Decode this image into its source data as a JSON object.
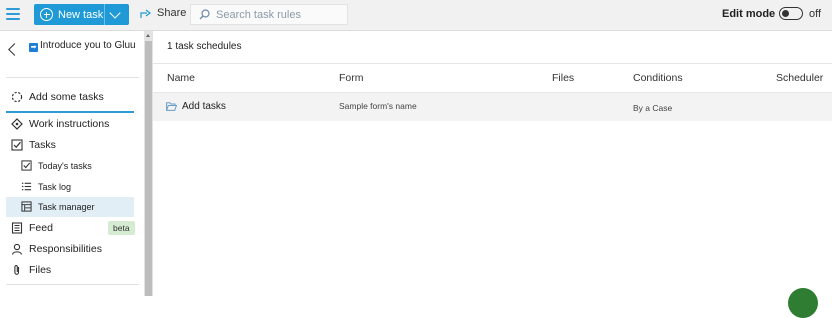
{
  "topbar": {
    "new_task_label": "New task",
    "share_label": "Share",
    "search_placeholder": "Search task rules",
    "edit_mode_label": "Edit mode",
    "edit_mode_state": "off"
  },
  "sidebar": {
    "intro_label": "Introduce you to Gluu",
    "items": [
      {
        "label": "Add some tasks",
        "icon": "dashed-circle-icon"
      },
      {
        "label": "Work instructions",
        "icon": "diamond-icon"
      },
      {
        "label": "Tasks",
        "icon": "checkbox-icon"
      },
      {
        "label": "Today's tasks",
        "icon": "checkbox-icon"
      },
      {
        "label": "Task log",
        "icon": "list-icon"
      },
      {
        "label": "Task manager",
        "icon": "table-icon"
      },
      {
        "label": "Feed",
        "icon": "feed-icon"
      },
      {
        "label": "Responsibilities",
        "icon": "person-icon"
      },
      {
        "label": "Files",
        "icon": "paperclip-icon"
      }
    ],
    "feed_badge": "beta"
  },
  "main": {
    "count_label": "1 task schedules",
    "columns": [
      "Name",
      "Form",
      "Files",
      "Conditions",
      "Scheduler"
    ],
    "rows": [
      {
        "name": "Add tasks",
        "form": "Sample form's name",
        "files": "",
        "conditions": "By a Case",
        "scheduler": ""
      }
    ]
  },
  "colors": {
    "accent": "#1f9ad6",
    "active_nav_bg": "#e1eef6",
    "badge_bg": "#d5ecd2"
  }
}
